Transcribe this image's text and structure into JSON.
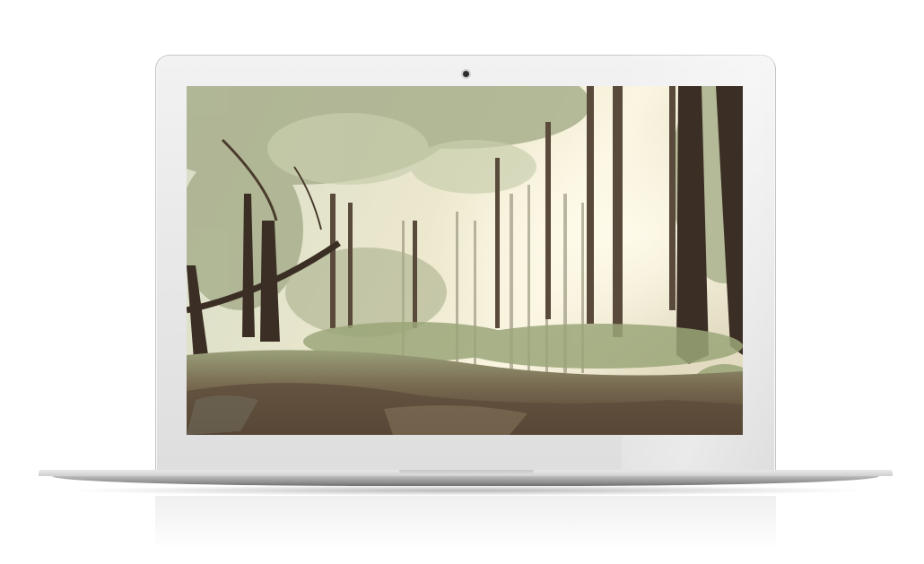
{
  "scene": {
    "subject": "laptop-mockup",
    "wallpaper": "forest-photo",
    "colors": {
      "lid": "#e4e4e4",
      "base": "#a9a9a9",
      "camera": "#2b2b2b",
      "sky": "#f4f1dc",
      "foliage": "#a8b08e",
      "trunk": "#3f3227",
      "ground": "#6b5b45"
    }
  }
}
